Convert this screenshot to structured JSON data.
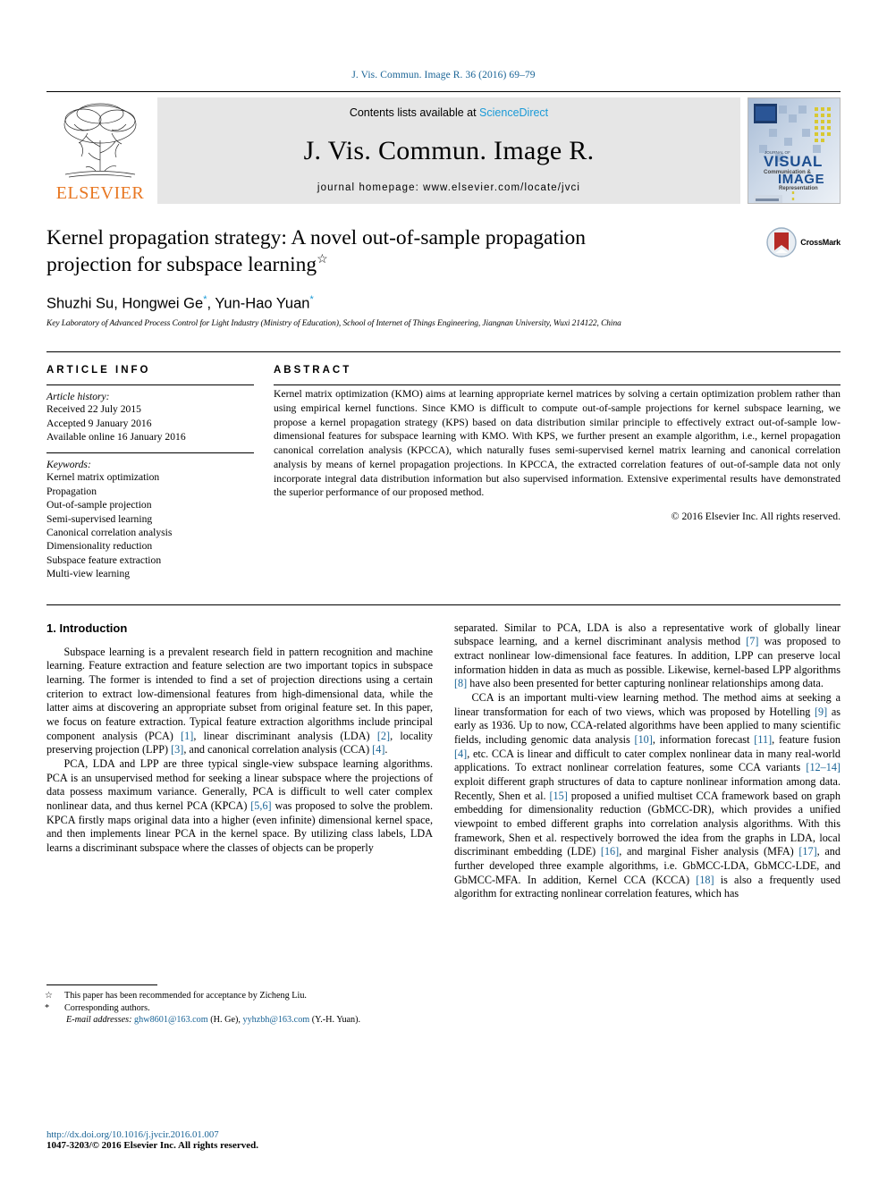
{
  "running_head": "J. Vis. Commun. Image R. 36 (2016) 69–79",
  "masthead": {
    "publisher": "ELSEVIER",
    "contents_prefix": "Contents lists available at ",
    "contents_link": "ScienceDirect",
    "journal_title": "J. Vis. Commun. Image R.",
    "homepage": "journal homepage: www.elsevier.com/locate/jvci",
    "cover_alt": "journal-cover-thumbnail",
    "cover_text_1": "VISUAL",
    "cover_text_2": "Communication &",
    "cover_text_3": "IMAGE",
    "cover_text_4": "Representation"
  },
  "article": {
    "title_line1": "Kernel propagation strategy: A novel out-of-sample propagation",
    "title_line2": "projection for subspace learning",
    "title_footnote_marker": "☆",
    "authors": "Shuzhi Su, Hongwei Ge",
    "authors_tail": ", Yun-Hao Yuan",
    "author_marker": "*",
    "affiliation": "Key Laboratory of Advanced Process Control for Light Industry (Ministry of Education), School of Internet of Things Engineering, Jiangnan University, Wuxi 214122, China",
    "crossmark_label": "CrossMark"
  },
  "article_info": {
    "heading": "ARTICLE INFO",
    "history_head": "Article history:",
    "history": [
      "Received 22 July 2015",
      "Accepted 9 January 2016",
      "Available online 16 January 2016"
    ],
    "keywords_head": "Keywords:",
    "keywords": [
      "Kernel matrix optimization",
      "Propagation",
      "Out-of-sample projection",
      "Semi-supervised learning",
      "Canonical correlation analysis",
      "Dimensionality reduction",
      "Subspace feature extraction",
      "Multi-view learning"
    ]
  },
  "abstract": {
    "heading": "ABSTRACT",
    "text": "Kernel matrix optimization (KMO) aims at learning appropriate kernel matrices by solving a certain optimization problem rather than using empirical kernel functions. Since KMO is difficult to compute out-of-sample projections for kernel subspace learning, we propose a kernel propagation strategy (KPS) based on data distribution similar principle to effectively extract out-of-sample low-dimensional features for subspace learning with KMO. With KPS, we further present an example algorithm, i.e., kernel propagation canonical correlation analysis (KPCCA), which naturally fuses semi-supervised kernel matrix learning and canonical correlation analysis by means of kernel propagation projections. In KPCCA, the extracted correlation features of out-of-sample data not only incorporate integral data distribution information but also supervised information. Extensive experimental results have demonstrated the superior performance of our proposed method.",
    "copyright": "© 2016 Elsevier Inc. All rights reserved."
  },
  "body": {
    "section_title": "1. Introduction",
    "left_paragraphs": [
      "Subspace learning is a prevalent research field in pattern recognition and machine learning. Feature extraction and feature selection are two important topics in subspace learning. The former is intended to find a set of projection directions using a certain criterion to extract low-dimensional features from high-dimensional data, while the latter aims at discovering an appropriate subset from original feature set. In this paper, we focus on feature extraction. Typical feature extraction algorithms include principal component analysis (PCA) [1], linear discriminant analysis (LDA) [2], locality preserving projection (LPP) [3], and canonical correlation analysis (CCA) [4].",
      "PCA, LDA and LPP are three typical single-view subspace learning algorithms. PCA is an unsupervised method for seeking a linear subspace where the projections of data possess maximum variance. Generally, PCA is difficult to well cater complex nonlinear data, and thus kernel PCA (KPCA) [5,6] was proposed to solve the problem. KPCA firstly maps original data into a higher (even infinite) dimensional kernel space, and then implements linear PCA in the kernel space. By utilizing class labels, LDA learns a discriminant subspace where the classes of objects can be properly"
    ],
    "right_paragraphs": [
      "separated. Similar to PCA, LDA is also a representative work of globally linear subspace learning, and a kernel discriminant analysis method [7] was proposed to extract nonlinear low-dimensional face features. In addition, LPP can preserve local information hidden in data as much as possible. Likewise, kernel-based LPP algorithms [8] have also been presented for better capturing nonlinear relationships among data.",
      "CCA is an important multi-view learning method. The method aims at seeking a linear transformation for each of two views, which was proposed by Hotelling [9] as early as 1936. Up to now, CCA-related algorithms have been applied to many scientific fields, including genomic data analysis [10], information forecast [11], feature fusion [4], etc. CCA is linear and difficult to cater complex nonlinear data in many real-world applications. To extract nonlinear correlation features, some CCA variants [12–14] exploit different graph structures of data to capture nonlinear information among data. Recently, Shen et al. [15] proposed a unified multiset CCA framework based on graph embedding for dimensionality reduction (GbMCC-DR), which provides a unified viewpoint to embed different graphs into correlation analysis algorithms. With this framework, Shen et al. respectively borrowed the idea from the graphs in LDA, local discriminant embedding (LDE) [16], and marginal Fisher analysis (MFA) [17], and further developed three example algorithms, i.e. GbMCC-LDA, GbMCC-LDE, and GbMCC-MFA. In addition, Kernel CCA (KCCA) [18] is also a frequently used algorithm for extracting nonlinear correlation features, which has"
    ]
  },
  "footnotes": {
    "recommendation": "This paper has been recommended for acceptance by Zicheng Liu.",
    "corresponding": "Corresponding authors.",
    "email_label": "E-mail addresses:",
    "email1": "ghw8601@163.com",
    "email1_owner": "(H. Ge),",
    "email2": "yyhzbh@163.com",
    "email2_owner": "(Y.-H. Yuan)."
  },
  "footer": {
    "doi": "http://dx.doi.org/10.1016/j.jvcir.2016.01.007",
    "issn": "1047-3203/© 2016 Elsevier Inc. All rights reserved."
  },
  "colors": {
    "link": "#1a6496",
    "sciencedirect": "#1a9ad7",
    "elsevier_orange": "#E87722",
    "masthead_bg": "#e6e6e6",
    "crossmark_red": "#B52B27"
  }
}
